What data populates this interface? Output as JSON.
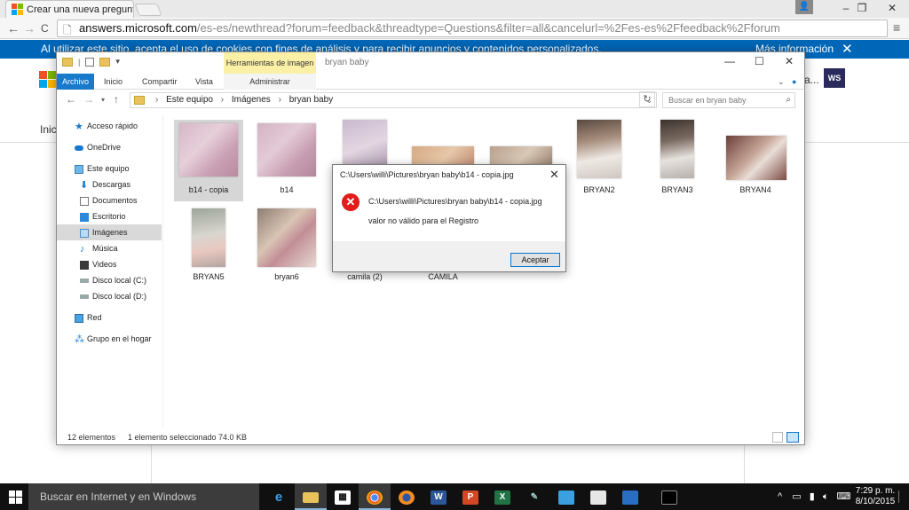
{
  "browser": {
    "tab_title": "Crear una nueva pregunta",
    "tab_close": "×",
    "user_button": "👤",
    "window_controls": {
      "minimize": "–",
      "restore": "❐",
      "close": "✕"
    },
    "back": "←",
    "forward": "→",
    "refresh": "C",
    "url_host": "answers.microsoft.com",
    "url_path": "/es-es/newthread?forum=feedback&threadtype=Questions&filter=all&cancelurl=%2Fes-es%2Ffeedback%2Fforum",
    "menu": "≡"
  },
  "page": {
    "cookie_text": "Al utilizar este sitio, acepta el uso de cookies con fines de análisis y para recibir anuncios y contenidos personalizados.",
    "cookie_more": "Más información",
    "cookie_close": "✕",
    "nav_fragment": "Inic",
    "header_fragment": "a...",
    "badge": "WS"
  },
  "explorer": {
    "contextual_tab": "Herramientas de imagen",
    "window_title": "bryan baby",
    "controls": {
      "minimize": "—",
      "maximize": "☐",
      "close": "✕"
    },
    "ribbon_tabs": [
      "Archivo",
      "Inicio",
      "Compartir",
      "Vista",
      "Administrar"
    ],
    "breadcrumb": [
      "Este equipo",
      "Imágenes",
      "bryan baby"
    ],
    "search_placeholder": "Buscar en bryan baby",
    "nav": {
      "quick_access": "Acceso rápido",
      "onedrive": "OneDrive",
      "this_pc": "Este equipo",
      "downloads": "Descargas",
      "documents": "Documentos",
      "desktop": "Escritorio",
      "pictures": "Imágenes",
      "music": "Música",
      "videos": "Videos",
      "disk_c": "Disco local (C:)",
      "disk_d": "Disco local (D:)",
      "network": "Red",
      "homegroup": "Grupo en el hogar"
    },
    "files": [
      "b14 - copia",
      "b14",
      "",
      "",
      "",
      "BRYAN2",
      "BRYAN3",
      "BRYAN4",
      "BRYAN5",
      "bryan6",
      "camila (2)",
      "CAMILA"
    ],
    "status_count": "12 elementos",
    "status_selected": "1 elemento seleccionado",
    "status_size": "74.0 KB"
  },
  "dialog": {
    "title": "C:\\Users\\willi\\Pictures\\bryan baby\\b14 - copia.jpg",
    "close": "✕",
    "message_path": "C:\\Users\\willi\\Pictures\\bryan baby\\b14 - copia.jpg",
    "message": "valor no válido para el Registro",
    "ok_label": "Aceptar"
  },
  "taskbar": {
    "search_placeholder": "Buscar en Internet y en Windows",
    "time": "7:29 p. m.",
    "date": "8/10/2015",
    "tray_up": "^"
  },
  "colors": {
    "accent": "#0067b8",
    "error": "#e21b1b",
    "selection": "#d9d9d9"
  }
}
